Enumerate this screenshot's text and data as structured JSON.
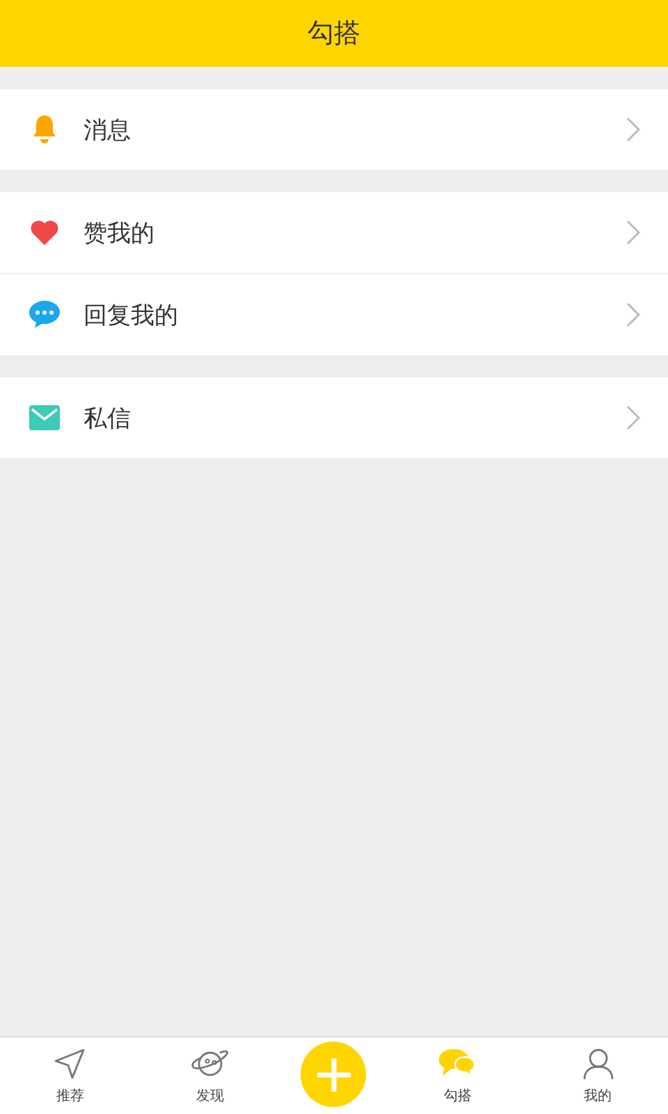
{
  "header": {
    "title": "勾搭"
  },
  "groups": [
    {
      "items": [
        {
          "kind": "bell",
          "label": "消息"
        }
      ]
    },
    {
      "items": [
        {
          "kind": "heart",
          "label": "赞我的"
        },
        {
          "kind": "bubble",
          "label": "回复我的"
        }
      ]
    },
    {
      "items": [
        {
          "kind": "mail",
          "label": "私信"
        }
      ]
    }
  ],
  "tabs": [
    {
      "kind": "navigate",
      "label": "推荐",
      "selected": false
    },
    {
      "kind": "planet",
      "label": "发现",
      "selected": false
    },
    {
      "kind": "add",
      "selected": false
    },
    {
      "kind": "chat",
      "label": "勾搭",
      "selected": true
    },
    {
      "kind": "person",
      "label": "我的",
      "selected": false
    }
  ]
}
